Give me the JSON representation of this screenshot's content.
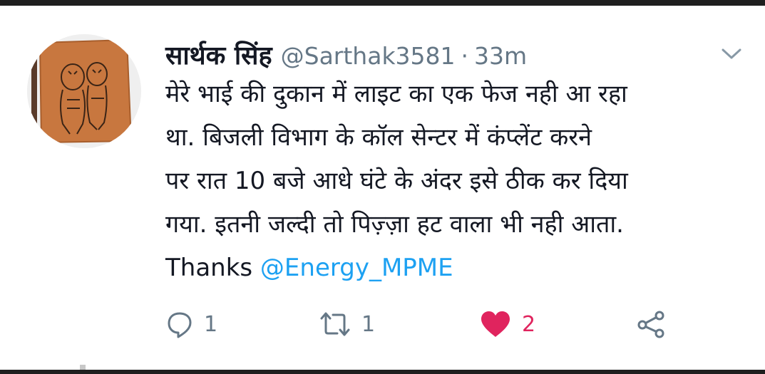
{
  "colors": {
    "text": "#141823",
    "muted": "#657786",
    "link": "#1da1f2",
    "like": "#e0245e",
    "avatar_bg": "#c8773f"
  },
  "tweet": {
    "author_name": "सार्थक सिंह",
    "handle": "@Sarthak3581",
    "separator": "·",
    "time": "33m",
    "body_lines": [
      "मेरे भाई की दुकान में लाइट का एक फेज नही आ रहा",
      "था. बिजली विभाग के कॉल सेन्टर में  कंप्लेंट करने",
      "पर रात 10 बजे आधे घंटे के अंदर इसे ठीक कर दिया",
      "गया. इतनी जल्दी तो पिज़्ज़ा हट वाला भी नही आता."
    ],
    "thanks_text": "Thanks ",
    "mention": "@Energy_MPME",
    "icons": {
      "menu": "chevron-down-icon",
      "reply": "reply-icon",
      "retweet": "retweet-icon",
      "like": "heart-icon",
      "share": "share-icon"
    },
    "reply_count": "1",
    "retweet_count": "1",
    "like_count": "2"
  }
}
